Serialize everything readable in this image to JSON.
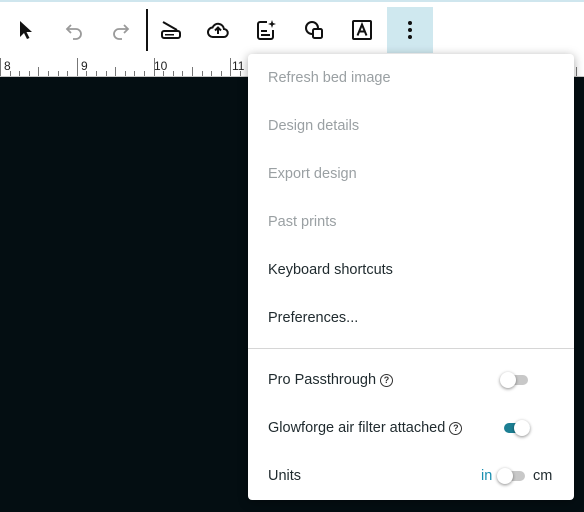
{
  "ruler": {
    "labels": [
      "8",
      "9",
      "10",
      "11"
    ]
  },
  "toolbar": {
    "select_icon": "cursor-arrow-icon",
    "undo_icon": "undo-icon",
    "redo_icon": "redo-icon",
    "scan_icon": "scanner-icon",
    "upload_icon": "cloud-upload-icon",
    "create_icon": "design-sparkle-icon",
    "shapes_icon": "shapes-icon",
    "text_icon": "text-box-icon",
    "more_icon": "more-vertical-icon"
  },
  "menu": {
    "items": [
      {
        "label": "Refresh bed image",
        "enabled": false
      },
      {
        "label": "Design details",
        "enabled": false
      },
      {
        "label": "Export design",
        "enabled": false
      },
      {
        "label": "Past prints",
        "enabled": false
      },
      {
        "label": "Keyboard shortcuts",
        "enabled": true
      },
      {
        "label": "Preferences...",
        "enabled": true
      }
    ],
    "settings": {
      "pro_passthrough": {
        "label": "Pro Passthrough",
        "enabled": false
      },
      "air_filter": {
        "label": "Glowforge air filter attached",
        "enabled": true
      },
      "units": {
        "label": "Units",
        "left": "in",
        "right": "cm",
        "selected": "in"
      }
    },
    "help_glyph": "?"
  },
  "colors": {
    "accent": "#1c7f93",
    "active_tool_bg": "#cfe8ef",
    "canvas_bg": "#040e12"
  }
}
